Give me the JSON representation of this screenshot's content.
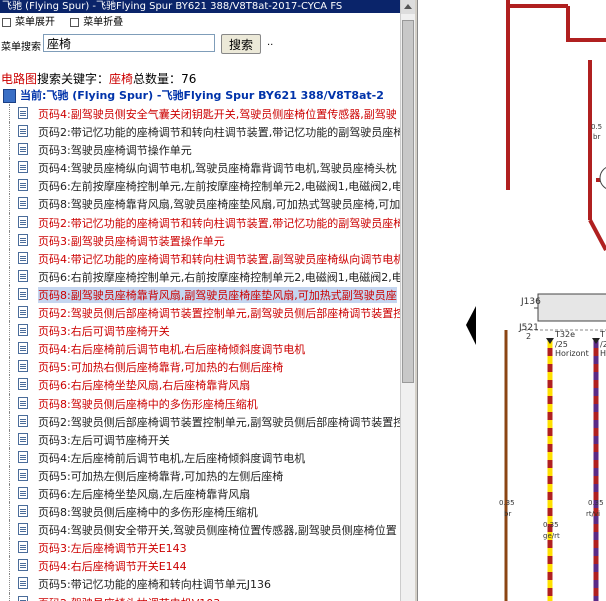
{
  "window_title": "飞驰 (Flying Spur) -飞驰Flying Spur BY621 388/V8T8at-2017-CYCA FS",
  "toolbar": {
    "expand_label": "菜单展开",
    "collapse_label": "菜单折叠"
  },
  "search": {
    "label": "菜单搜索",
    "value": "座椅",
    "button": "搜索",
    "ellipsis": ".."
  },
  "summary": {
    "prefix": "电路图",
    "text1": "搜索关键字：",
    "keyword": "座椅",
    "text2": "总数量：",
    "count": "76"
  },
  "current": "当前:飞驰 (Flying Spur) -飞驰Flying Spur BY621 388/V8T8at-2",
  "colors": {
    "selection": "#c5d6f0",
    "red_text": "#c00000",
    "title_bar": "#0a246a",
    "wire_red": "#b02020",
    "wire_yellow": "#ffe000"
  },
  "items": [
    {
      "label": "页码4:副驾驶员侧安全气囊关闭钥匙开关,驾驶员侧座椅位置传感器,副驾驶",
      "red": true
    },
    {
      "label": "页码2:带记忆功能的座椅调节和转向柱调节装置,带记忆功能的副驾驶员座椅",
      "red": false
    },
    {
      "label": "页码3:驾驶员座椅调节操作单元",
      "red": false
    },
    {
      "label": "页码4:驾驶员座椅纵向调节电机,驾驶员座椅靠背调节电机,驾驶员座椅头枕",
      "red": false
    },
    {
      "label": "页码6:左前按摩座椅控制单元,左前按摩座椅控制单元2,电磁阀1,电磁阀2,电",
      "red": false
    },
    {
      "label": "页码8:驾驶员座椅靠背风扇,驾驶员座椅座垫风扇,可加热式驾驶员座椅,可加",
      "red": false
    },
    {
      "label": "页码2:带记忆功能的座椅调节和转向柱调节装置,带记忆功能的副驾驶员座椅",
      "red": true
    },
    {
      "label": "页码3:副驾驶员座椅调节装置操作单元",
      "red": true
    },
    {
      "label": "页码4:带记忆功能的座椅调节和转向柱调节装置,副驾驶员座椅纵向调节电机",
      "red": true
    },
    {
      "label": "页码6:右前按摩座椅控制单元,右前按摩座椅控制单元2,电磁阀1,电磁阀2,电",
      "red": false
    },
    {
      "label": "页码8:副驾驶员座椅靠背风扇,副驾驶员座椅座垫风扇,可加热式副驾驶员座",
      "red": true,
      "selected": true
    },
    {
      "label": "页码2:驾驶员侧后部座椅调节装置控制单元,副驾驶员侧后部座椅调节装置控",
      "red": true
    },
    {
      "label": "页码3:右后可调节座椅开关",
      "red": true
    },
    {
      "label": "页码4:右后座椅前后调节电机,右后座椅倾斜度调节电机",
      "red": true
    },
    {
      "label": "页码5:可加热右侧后座椅靠背,可加热的右侧后座椅",
      "red": true
    },
    {
      "label": "页码6:右后座椅坐垫风扇,右后座椅靠背风扇",
      "red": true
    },
    {
      "label": "页码8:驾驶员侧后座椅中的多伤形座椅压缩机",
      "red": true
    },
    {
      "label": "页码2:驾驶员侧后部座椅调节装置控制单元,副驾驶员侧后部座椅调节装置控",
      "red": false
    },
    {
      "label": "页码3:左后可调节座椅开关",
      "red": false
    },
    {
      "label": "页码4:左后座椅前后调节电机,左后座椅倾斜度调节电机",
      "red": false
    },
    {
      "label": "页码5:可加热左侧后座椅靠背,可加热的左侧后座椅",
      "red": false
    },
    {
      "label": "页码6:左后座椅坐垫风扇,左后座椅靠背风扇",
      "red": false
    },
    {
      "label": "页码8:驾驶员侧后座椅中的多伤形座椅压缩机",
      "red": false
    },
    {
      "label": "页码4:驾驶员侧安全带开关,驾驶员侧座椅位置传感器,副驾驶员侧座椅位置",
      "red": false
    },
    {
      "label": "页码3:左后座椅调节开关E143",
      "red": true
    },
    {
      "label": "页码4:右后座椅调节开关E144",
      "red": true
    },
    {
      "label": "页码5:带记忆功能的座椅和转向柱调节单元J136",
      "red": false
    },
    {
      "label": "页码2:驾驶员座椅头枕调节电机V103",
      "red": true
    }
  ],
  "diagram": {
    "labels": {
      "j136": "J136",
      "j521": "J521",
      "j521_sub": "2",
      "t32e": "T32e",
      "t32e_pin": "/25",
      "t32e_desc": "Horizont",
      "t_right": "T",
      "t_right_pin": "/2",
      "t_right_desc": "H",
      "wire1_size": "0.5",
      "wire1_color": "br",
      "wire2_size": "0.35",
      "wire2_color": "br",
      "wire3_size": "0.35",
      "wire3_color": "ge/rt",
      "wire4_size": "0.35",
      "wire4_color": "rt/vi"
    }
  }
}
